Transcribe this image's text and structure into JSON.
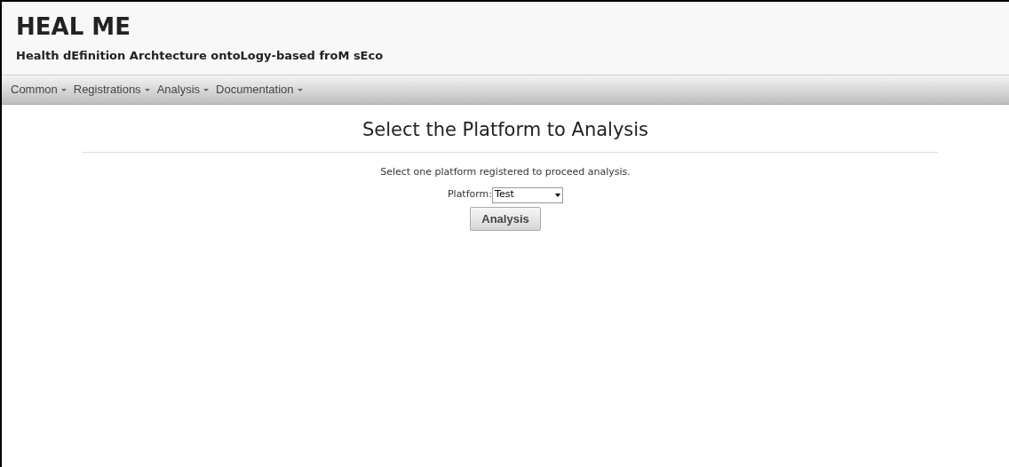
{
  "header": {
    "title": "HEAL ME",
    "subtitle": "Health dEfinition Archtecture ontoLogy-based froM sEco"
  },
  "menu": [
    {
      "label": "Common"
    },
    {
      "label": "Registrations"
    },
    {
      "label": "Analysis"
    },
    {
      "label": "Documentation"
    }
  ],
  "main": {
    "heading": "Select the Platform to Analysis",
    "description": "Select one platform registered to proceed analysis.",
    "field_label": "Platform:",
    "select_value": "Test",
    "button": "Analysis"
  }
}
